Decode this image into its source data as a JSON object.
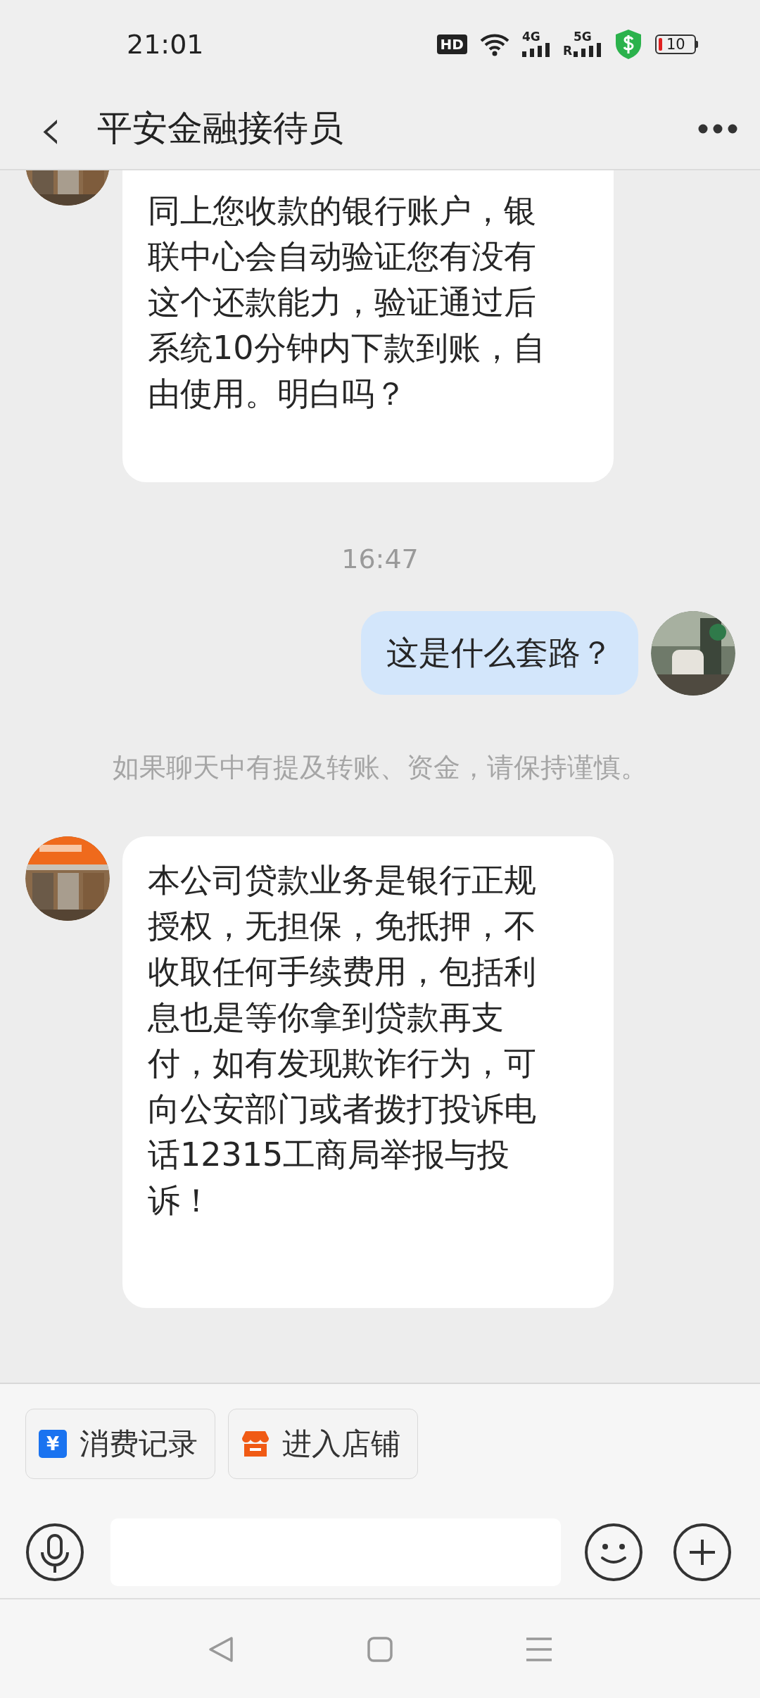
{
  "status_bar": {
    "time": "21:01",
    "hd_label": "HD",
    "network_4g": "4G",
    "network_5g": "5G",
    "roaming": "R",
    "battery": "10"
  },
  "header": {
    "back": "‹",
    "title": "平安金融接待员"
  },
  "messages": [
    {
      "kind": "incoming",
      "clipped": true,
      "text": "同上您收款的银行账户，银联中心会自动验证您有没有这个还款能力，验证通过后系统10分钟内下款到账，自由使用。明白吗？"
    },
    {
      "kind": "time",
      "text": "16:47"
    },
    {
      "kind": "outgoing",
      "text": "这是什么套路？"
    },
    {
      "kind": "notice",
      "text": "如果聊天中有提及转账、资金，请保持谨慎。"
    },
    {
      "kind": "incoming",
      "clipped": false,
      "text": "本公司贷款业务是银行正规授权，无担保，免抵押，不收取任何手续费用，包括利息也是等你拿到贷款再支付，如有发现欺诈行为，可向公安部门或者拨打投诉电话12315工商局举报与投诉！"
    }
  ],
  "quick_actions": [
    {
      "kind": "bill",
      "icon_text": "¥",
      "label": "消费记录"
    },
    {
      "kind": "shop",
      "label": "进入店铺"
    }
  ]
}
